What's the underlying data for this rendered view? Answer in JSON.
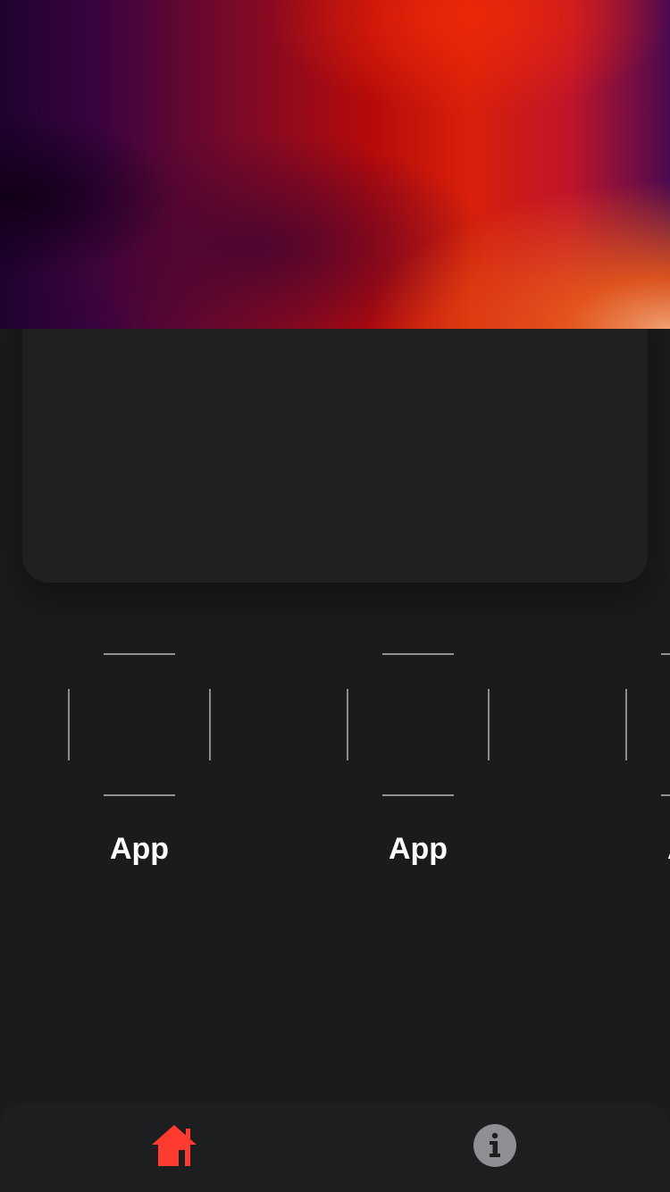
{
  "apps": [
    {
      "label": "App",
      "icon": "app-placeholder-icon"
    },
    {
      "label": "App",
      "icon": "app-placeholder-icon"
    },
    {
      "label": "App",
      "icon": "app-placeholder-icon"
    }
  ],
  "tabbar": {
    "items": [
      {
        "icon": "home-icon",
        "active": true,
        "color": "#ff3b30"
      },
      {
        "icon": "info-icon",
        "active": false,
        "color": "#8e8e93"
      }
    ]
  },
  "colors": {
    "background": "#1a1b1d",
    "card": "#1f2022",
    "accent": "#ff3b30"
  }
}
